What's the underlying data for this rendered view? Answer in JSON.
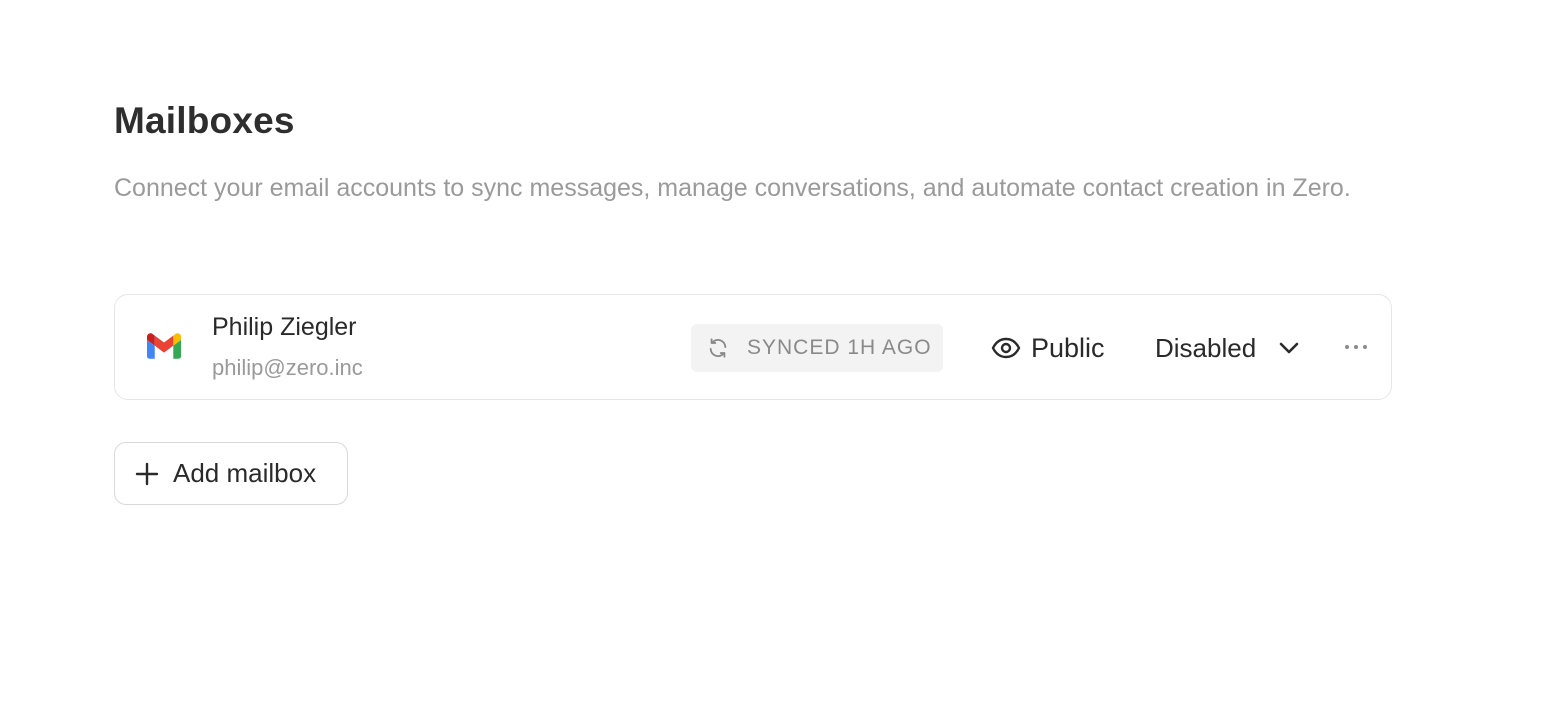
{
  "header": {
    "title": "Mailboxes",
    "description": "Connect your email accounts to sync messages, manage conversations, and automate contact creation in Zero."
  },
  "mailboxes": [
    {
      "provider_icon": "gmail-icon",
      "name": "Philip Ziegler",
      "email": "philip@zero.inc",
      "sync_status": "SYNCED 1H AGO",
      "sync_icon": "refresh-icon",
      "visibility": "Public",
      "visibility_icon": "eye-icon",
      "status": "Disabled",
      "status_icon": "chevron-down-icon",
      "more_icon": "more-horizontal-icon"
    }
  ],
  "actions": {
    "add_mailbox_label": "Add mailbox",
    "add_icon": "plus-icon"
  },
  "colors": {
    "text_primary": "#2a2a2a",
    "text_muted": "#9a9a9a",
    "badge_bg": "#f3f3f3",
    "border": "#e6e6e6",
    "gmail_red": "#EA4335",
    "gmail_blue": "#4285F4",
    "gmail_green": "#34A853",
    "gmail_yellow": "#FBBC04",
    "gmail_dark_red": "#C5221F"
  }
}
